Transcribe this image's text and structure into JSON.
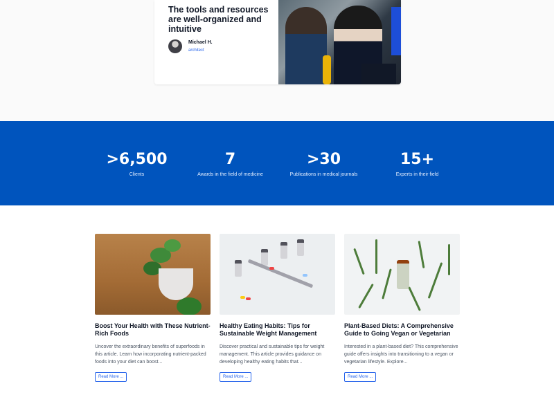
{
  "testimonial": {
    "quote": "The tools and resources are well-organized and intuitive",
    "author_name": "Michael H.",
    "author_role": "architect"
  },
  "stats": [
    {
      "value": ">6,500",
      "label": "Clients"
    },
    {
      "value": "7",
      "label": "Awards in the field of medicine"
    },
    {
      "value": ">30",
      "label": "Publications in medical journals"
    },
    {
      "value": "15+",
      "label": "Experts in their field"
    }
  ],
  "articles": [
    {
      "title": "Boost Your Health with These Nutrient-Rich Foods",
      "description": "Uncover the extraordinary benefits of superfoods in this article. Learn how incorporating nutrient-packed foods into your diet can boost...",
      "button": "Read More ..."
    },
    {
      "title": "Healthy Eating Habits: Tips for Sustainable Weight Management",
      "description": "Discover practical and sustainable tips for weight management. This article provides guidance on developing healthy eating habits that...",
      "button": "Read More ..."
    },
    {
      "title": "Plant-Based Diets: A Comprehensive Guide to Going Vegan or Vegetarian",
      "description": "Interested in a plant-based diet? This comprehensive guide offers insights into transitioning to a vegan or vegetarian lifestyle. Explore...",
      "button": "Read More ..."
    }
  ],
  "colors": {
    "stats_band": "#0054bd",
    "accent": "#2563eb"
  }
}
